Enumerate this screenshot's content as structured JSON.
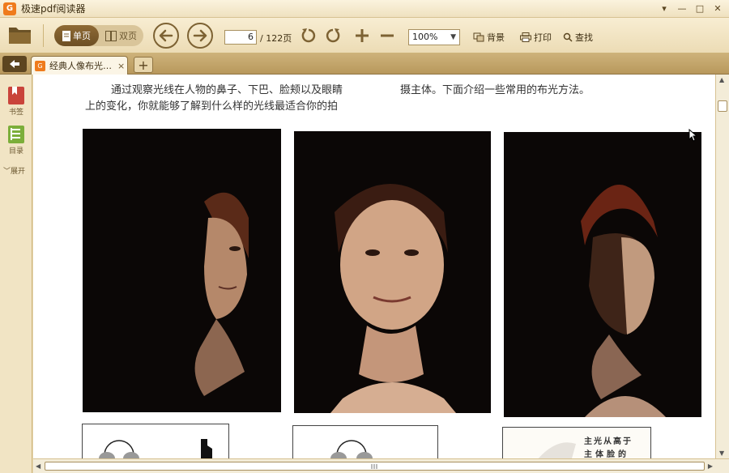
{
  "app": {
    "logo_text": "G",
    "title": "极速pdf阅读器"
  },
  "window_controls": {
    "menu": "▾",
    "minimize": "—",
    "maximize": "□",
    "close": "✕"
  },
  "toolbar": {
    "single_page_label": "单页",
    "double_page_label": "双页",
    "current_page": "6",
    "total_pages": "/ 122页",
    "zoom_value": "100%",
    "background_label": "背景",
    "print_label": "打印",
    "find_label": "查找"
  },
  "tabs": {
    "items": [
      {
        "label": "经典人像布光…",
        "close": "×"
      }
    ],
    "new_tab": "+"
  },
  "sidebar": {
    "bookmark_label": "书签",
    "toc_label": "目录",
    "expand_label": "展开"
  },
  "document": {
    "line1_left": "通过观察光线在人物的鼻子、下巴、脸颊以及眼睛",
    "line1_right": "摄主体。下面介绍一些常用的布光方法。",
    "line2_left": "上的变化，你就能够了解到什么样的光线最适合你的拍",
    "caption_line1": "主光从高于",
    "caption_line2": "主体脸的"
  },
  "colors": {
    "accent": "#ef7b1c",
    "toolbar_bg": "#f2e4c3",
    "active_button": "#7d5c2c",
    "photo_bg": "#0b0706"
  }
}
